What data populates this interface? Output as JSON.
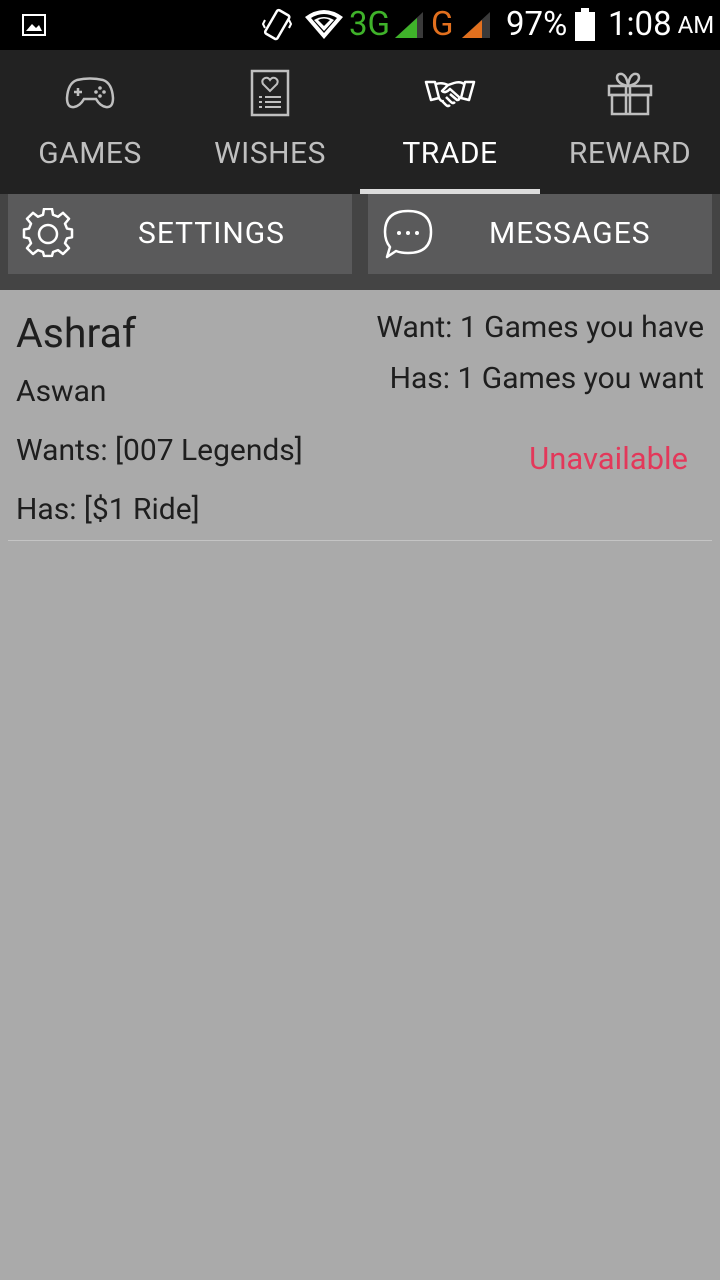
{
  "status_bar": {
    "network_3g": "3G",
    "network_g": "G",
    "battery_percent": "97%",
    "time": "1:08",
    "time_suffix": "AM"
  },
  "tabs": [
    {
      "label": "GAMES",
      "icon": "gamepad-icon",
      "active": false
    },
    {
      "label": "WISHES",
      "icon": "wishlist-icon",
      "active": false
    },
    {
      "label": "TRADE",
      "icon": "handshake-icon",
      "active": true
    },
    {
      "label": "REWARD",
      "icon": "gift-icon",
      "active": false
    }
  ],
  "actions": {
    "settings_label": "SETTINGS",
    "messages_label": "MESSAGES"
  },
  "trade": {
    "name": "Ashraf",
    "location": "Aswan",
    "wants": "Wants: [007 Legends]",
    "has": "Has: [$1 Ride]",
    "want_summary": "Want: 1 Games you have",
    "has_summary": "Has: 1 Games you want",
    "status": "Unavailable"
  },
  "colors": {
    "status_unavailable": "#e3385a",
    "network_3g": "#3fb22a",
    "network_g": "#e2701e"
  }
}
